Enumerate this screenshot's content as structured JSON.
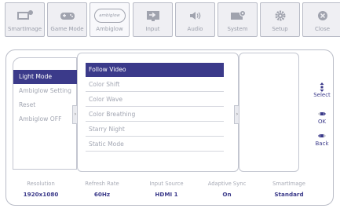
{
  "tabs": [
    {
      "label": "SmartImage",
      "icon": "smartimage-icon"
    },
    {
      "label": "Game Mode",
      "icon": "gamepad-icon"
    },
    {
      "label": "Ambiglow",
      "icon": "ambiglow-icon",
      "icon_text": "ambiglow",
      "active": true
    },
    {
      "label": "Input",
      "icon": "input-icon"
    },
    {
      "label": "Audio",
      "icon": "speaker-icon"
    },
    {
      "label": "System",
      "icon": "system-icon"
    },
    {
      "label": "Setup",
      "icon": "gear-icon"
    },
    {
      "label": "Close",
      "icon": "close-icon"
    }
  ],
  "left_menu": [
    "Light Mode",
    "Ambiglow Setting",
    "Reset",
    "Ambiglow OFF"
  ],
  "middle_menu": [
    "Follow Video",
    "Color Shift",
    "Color Wave",
    "Color Breathing",
    "Starry Night",
    "Static Mode"
  ],
  "controls": {
    "select": "Select",
    "ok": "OK",
    "back": "Back"
  },
  "status": [
    {
      "label": "Resolution",
      "value": "1920x1080"
    },
    {
      "label": "Refresh Rate",
      "value": "60Hz"
    },
    {
      "label": "Input Source",
      "value": "HDMI 1"
    },
    {
      "label": "Adaptive Sync",
      "value": "On"
    },
    {
      "label": "SmartImage",
      "value": "Standard"
    }
  ],
  "colors": {
    "accent": "#3b3a8a",
    "icon": "#a0a3ae"
  }
}
